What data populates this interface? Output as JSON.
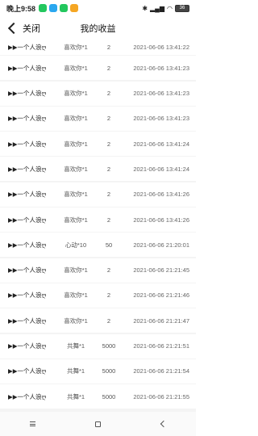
{
  "status": {
    "time": "晚上9:58",
    "app_badge_colors": [
      "#23c75e",
      "#2aa7ef",
      "#23c75e",
      "#f5a623"
    ],
    "battery": "36"
  },
  "nav": {
    "back_label": "关闭",
    "title": "我的收益"
  },
  "columns_hint": [
    "user",
    "gift",
    "amount",
    "time"
  ],
  "records": [
    {
      "user": "▶▶一个人浪ღ",
      "gift": "喜欢你*1",
      "amount": "2",
      "time": "2021-06-06 13:41:22"
    },
    {
      "user": "▶▶一个人浪ღ",
      "gift": "喜欢你*1",
      "amount": "2",
      "time": "2021-06-06 13:41:23"
    },
    {
      "user": "▶▶一个人浪ღ",
      "gift": "喜欢你*1",
      "amount": "2",
      "time": "2021-06-06 13:41:23"
    },
    {
      "user": "▶▶一个人浪ღ",
      "gift": "喜欢你*1",
      "amount": "2",
      "time": "2021-06-06 13:41:23"
    },
    {
      "user": "▶▶一个人浪ღ",
      "gift": "喜欢你*1",
      "amount": "2",
      "time": "2021-06-06 13:41:24"
    },
    {
      "user": "▶▶一个人浪ღ",
      "gift": "喜欢你*1",
      "amount": "2",
      "time": "2021-06-06 13:41:24"
    },
    {
      "user": "▶▶一个人浪ღ",
      "gift": "喜欢你*1",
      "amount": "2",
      "time": "2021-06-06 13:41:26"
    },
    {
      "user": "▶▶一个人浪ღ",
      "gift": "喜欢你*1",
      "amount": "2",
      "time": "2021-06-06 13:41:26"
    },
    {
      "user": "▶▶一个人浪ღ",
      "gift": "心动*10",
      "amount": "50",
      "time": "2021-06-06 21:20:01"
    },
    {
      "user": "▶▶一个人浪ღ",
      "gift": "喜欢你*1",
      "amount": "2",
      "time": "2021-06-06 21:21:45"
    },
    {
      "user": "▶▶一个人浪ღ",
      "gift": "喜欢你*1",
      "amount": "2",
      "time": "2021-06-06 21:21:46"
    },
    {
      "user": "▶▶一个人浪ღ",
      "gift": "喜欢你*1",
      "amount": "2",
      "time": "2021-06-06 21:21:47"
    },
    {
      "user": "▶▶一个人浪ღ",
      "gift": "共舞*1",
      "amount": "5000",
      "time": "2021-06-06 21:21:51"
    },
    {
      "user": "▶▶一个人浪ღ",
      "gift": "共舞*1",
      "amount": "5000",
      "time": "2021-06-06 21:21:54"
    },
    {
      "user": "▶▶一个人浪ღ",
      "gift": "共舞*1",
      "amount": "5000",
      "time": "2021-06-06 21:21:55"
    }
  ]
}
